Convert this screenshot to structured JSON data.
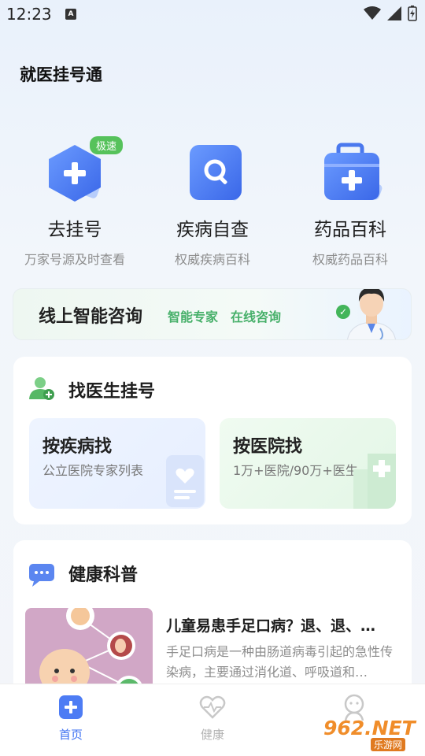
{
  "status_bar": {
    "time": "12:23",
    "notification_letter": "A"
  },
  "app": {
    "title": "就医挂号通"
  },
  "services": [
    {
      "title": "去挂号",
      "subtitle": "万家号源及时查看",
      "badge": "极速",
      "icon": "hospital-plus-icon"
    },
    {
      "title": "疾病自查",
      "subtitle": "权威疾病百科",
      "icon": "search-icon"
    },
    {
      "title": "药品百科",
      "subtitle": "权威药品百科",
      "icon": "medicine-kit-icon"
    }
  ],
  "consult": {
    "title": "线上智能咨询",
    "tag1": "智能专家",
    "tag2": "在线咨询"
  },
  "find_doctor": {
    "title": "找医生挂号",
    "by_disease": {
      "title": "按疾病找",
      "desc": "公立医院专家列表"
    },
    "by_hospital": {
      "title": "按医院找",
      "desc": "1万+医院/90万+医生"
    }
  },
  "health": {
    "title": "健康科普",
    "article": {
      "title": "儿童易患手足口病？退、退、…",
      "desc": "手足口病是一种由肠道病毒引起的急性传染病，主要通过消化道、呼吸道和…"
    }
  },
  "bottom_nav": [
    {
      "label": "首页",
      "active": true,
      "icon": "home-plus-icon"
    },
    {
      "label": "健康",
      "active": false,
      "icon": "heart-pulse-icon"
    },
    {
      "label": "",
      "active": false,
      "icon": "profile-icon"
    }
  ],
  "watermark": {
    "main": "962.NET",
    "sub": "乐游网"
  },
  "colors": {
    "accent_blue": "#3b6ff2",
    "accent_green": "#47b06a",
    "badge_green": "#56c25b"
  }
}
